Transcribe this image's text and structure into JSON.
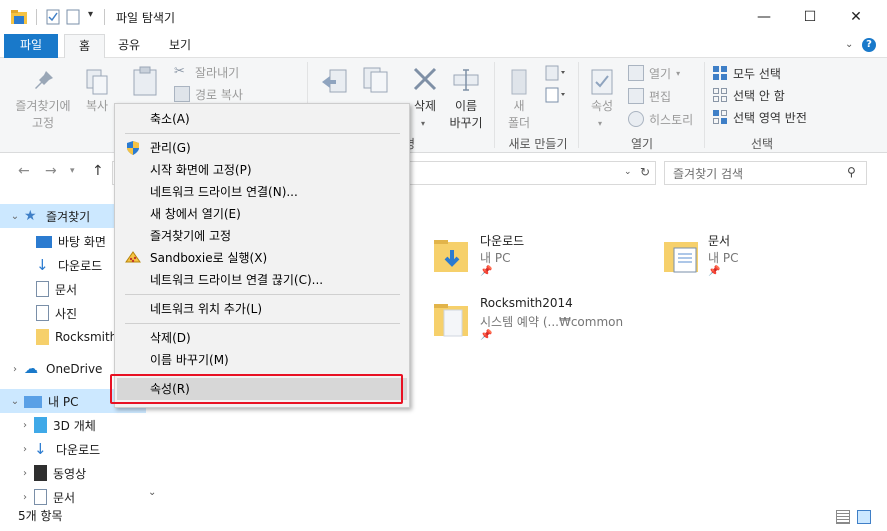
{
  "window": {
    "title": "파일 탐색기",
    "controls": {
      "minimize": "—",
      "maximize": "☐",
      "close": "✕"
    }
  },
  "tabs": [
    {
      "label": "파일"
    },
    {
      "label": "홈"
    },
    {
      "label": "공유"
    },
    {
      "label": "보기"
    }
  ],
  "ribbon": {
    "clipboard": {
      "pin_label_1": "즐겨찾기에",
      "pin_label_2": "고정",
      "copy": "복사",
      "cut": "잘라내기",
      "copy_path": "경로 복사"
    },
    "organize": {
      "delete": "삭제",
      "rename_1": "이름",
      "rename_2": "바꾸기"
    },
    "new": {
      "new_folder_1": "새",
      "new_folder_2": "폴더",
      "group": "새로 만들기"
    },
    "open": {
      "properties": "속성",
      "open": "열기",
      "edit": "편집",
      "history": "히스토리",
      "group": "열기"
    },
    "select": {
      "select_all": "모두 선택",
      "select_none": "선택 안 함",
      "invert": "선택 영역 반전",
      "group": "선택"
    }
  },
  "search": {
    "placeholder": "즐겨찾기 검색"
  },
  "nav": {
    "quick_access": "즐겨찾기",
    "items": [
      "바탕 화면",
      "다운로드",
      "문서",
      "사진",
      "Rocksmith2014"
    ],
    "onedrive": "OneDrive",
    "this_pc": "내 PC",
    "pc_items": [
      "3D 개체",
      "다운로드",
      "동영상",
      "문서"
    ]
  },
  "content": {
    "tiles": [
      {
        "name": "다운로드",
        "sub": "내 PC"
      },
      {
        "name": "문서",
        "sub": "내 PC"
      },
      {
        "name": "Rocksmith2014",
        "sub": "시스템 예약 (...₩common"
      }
    ]
  },
  "context_menu": {
    "items": [
      "축소(A)",
      "관리(G)",
      "시작 화면에 고정(P)",
      "네트워크 드라이브 연결(N)...",
      "새 창에서 열기(E)",
      "즐겨찾기에 고정",
      "Sandboxie로 실행(X)",
      "네트워크 드라이브 연결 끊기(C)...",
      "네트워크 위치 추가(L)",
      "삭제(D)",
      "이름 바꾸기(M)",
      "속성(R)"
    ]
  },
  "status": {
    "count": "5개 항목"
  },
  "colors": {
    "accent": "#1979ca",
    "selection": "#cce8ff",
    "highlight_border": "#e81123"
  }
}
